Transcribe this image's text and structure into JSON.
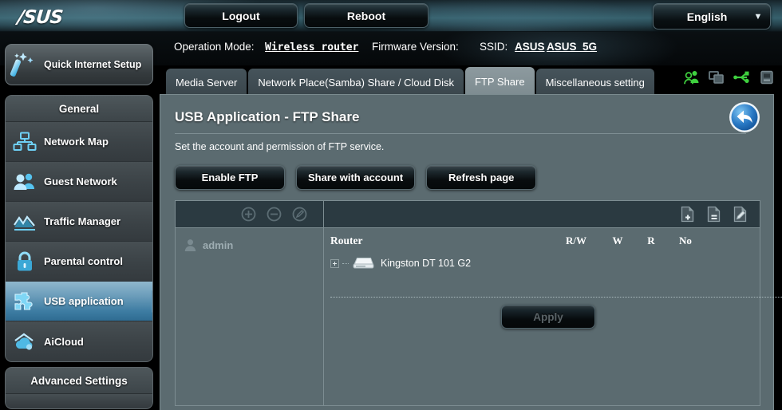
{
  "header": {
    "logo_text": "/SUS",
    "logout_label": "Logout",
    "reboot_label": "Reboot",
    "language": "English",
    "status_icons": [
      "users-icon",
      "clients-icon",
      "usb-icon",
      "printer-icon"
    ]
  },
  "info": {
    "operation_mode_label": "Operation Mode:",
    "operation_mode_value": "Wireless router",
    "firmware_label": "Firmware Version:",
    "ssid_label": "SSID:",
    "ssid_24g": "ASUS",
    "ssid_5g": "ASUS_5G"
  },
  "sidebar": {
    "quick_setup_label": "Quick Internet Setup",
    "general_header": "General",
    "general_items": [
      {
        "label": "Network Map",
        "icon": "network-map-icon",
        "active": false
      },
      {
        "label": "Guest Network",
        "icon": "guest-network-icon",
        "active": false
      },
      {
        "label": "Traffic Manager",
        "icon": "traffic-manager-icon",
        "active": false
      },
      {
        "label": "Parental control",
        "icon": "lock-icon",
        "active": false
      },
      {
        "label": "USB application",
        "icon": "puzzle-icon",
        "active": true
      },
      {
        "label": "AiCloud",
        "icon": "cloud-icon",
        "active": false
      }
    ],
    "advanced_header": "Advanced Settings"
  },
  "tabs": [
    {
      "label": "Media Server",
      "active": false
    },
    {
      "label": "Network Place(Samba) Share / Cloud Disk",
      "active": false
    },
    {
      "label": "FTP Share",
      "active": true
    },
    {
      "label": "Miscellaneous setting",
      "active": false
    }
  ],
  "page": {
    "title": "USB Application - FTP Share",
    "description": "Set the account and permission of FTP service.",
    "back_icon": "back-arrow-icon",
    "buttons": [
      {
        "label": "Enable FTP"
      },
      {
        "label": "Share with account"
      },
      {
        "label": "Refresh page"
      }
    ]
  },
  "share": {
    "left_toolbar": [
      "add-account-icon",
      "remove-account-icon",
      "edit-account-icon"
    ],
    "right_toolbar": [
      "add-folder-icon",
      "remove-folder-icon",
      "edit-folder-icon"
    ],
    "accounts": [
      {
        "name": "admin",
        "icon": "user-avatar-icon"
      }
    ],
    "router_label": "Router",
    "permission_columns": [
      "R/W",
      "W",
      "R",
      "No"
    ],
    "devices": [
      {
        "name": "Kingston DT 101 G2",
        "icon": "usb-drive-icon",
        "expandable": true
      }
    ],
    "apply_label": "Apply"
  },
  "colors": {
    "accent_blue": "#3e7da3",
    "panel_bg": "#5b6b70",
    "toolbar_bg": "#2b3a41",
    "status_green": "#3fd03f"
  }
}
